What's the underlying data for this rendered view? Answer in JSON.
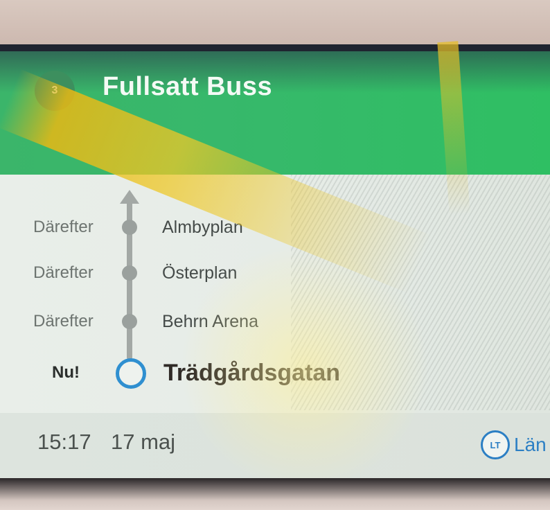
{
  "header": {
    "line_number": "3",
    "title": "Fullsatt Buss"
  },
  "stops": [
    {
      "when": "Därefter",
      "name": "Almbyplan"
    },
    {
      "when": "Därefter",
      "name": "Österplan"
    },
    {
      "when": "Därefter",
      "name": "Behrn Arena"
    }
  ],
  "current_stop": {
    "when": "Nu!",
    "name": "Trädgårdsgatan"
  },
  "footer": {
    "time": "15:17",
    "date": "17 maj",
    "brand_logo": "LT",
    "brand_name": "Län"
  },
  "colors": {
    "header_green": "#37b86b",
    "current_ring_blue": "#2f8fd0",
    "brand_blue": "#2c7fc4"
  },
  "icons": {
    "route_arrow": "arrow-up-icon",
    "stop_marker": "stop-dot-icon",
    "current_marker": "current-stop-ring-icon"
  }
}
